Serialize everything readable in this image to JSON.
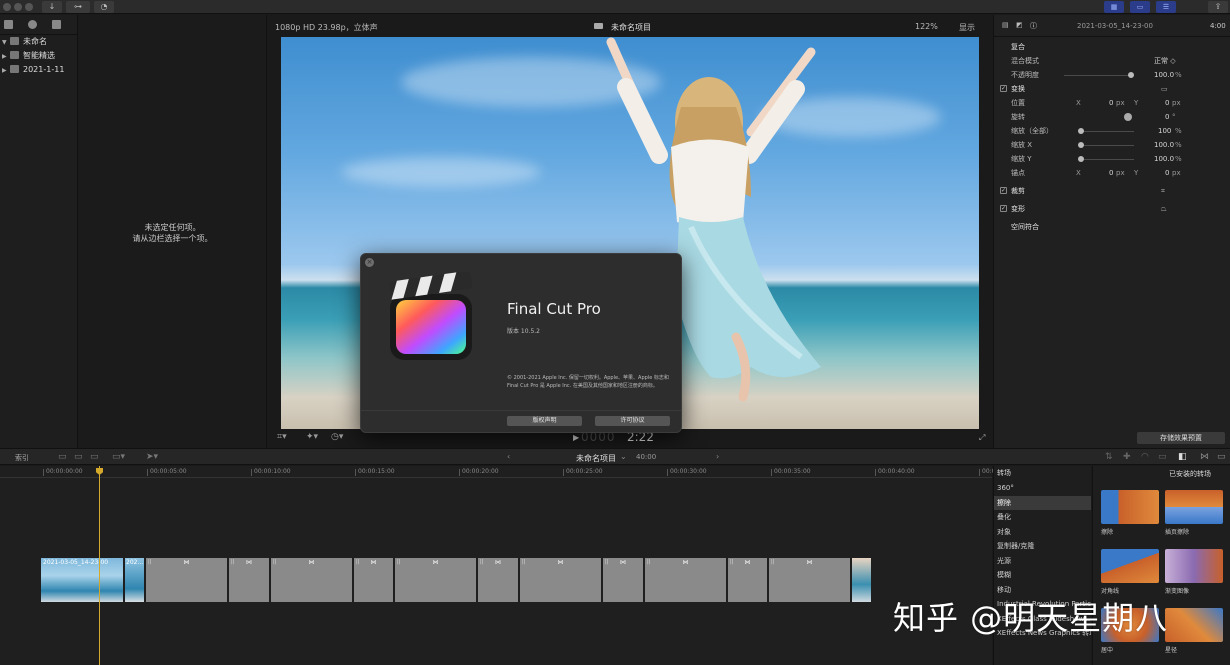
{
  "viewer": {
    "format": "1080p HD 23.98p，立体声",
    "project_title": "未命名项目",
    "zoom": "122%",
    "display_menu": "显示",
    "timecode": "2:22"
  },
  "library": {
    "items": [
      {
        "label": "未命名"
      },
      {
        "label": "智能精选"
      },
      {
        "label": "2021-1-11"
      }
    ]
  },
  "browser": {
    "empty_line1": "未选定任何项。",
    "empty_line2": "请从边栏选择一个项。"
  },
  "about": {
    "app_name": "Final Cut Pro",
    "version": "版本 10.5.2",
    "copyright": "© 2001-2021 Apple Inc. 保留一切权利。Apple、苹果、Apple 标志和 Final Cut Pro 是 Apple Inc. 在美国及其他国家和地区注册的商标。",
    "btn_license": "版权声明",
    "btn_agreement": "许可协议"
  },
  "inspector": {
    "clip_name": "2021-03-05_14-23-00",
    "duration": "4:00",
    "composite": {
      "title": "复合",
      "blend_label": "混合模式",
      "blend_value": "正常 ◇",
      "opacity_label": "不透明度",
      "opacity_value": "100.0",
      "opacity_unit": "%"
    },
    "transform": {
      "title": "变换",
      "position_label": "位置",
      "rotation_label": "旋转",
      "scale_all_label": "缩放（全部）",
      "scale_x_label": "缩放 X",
      "scale_y_label": "缩放 Y",
      "anchor_label": "锚点",
      "axis_x": "X",
      "axis_y": "Y",
      "zero": "0",
      "px": "px",
      "deg": "°",
      "pct": "%",
      "scale_all": "100",
      "scale_x": "100.0",
      "scale_y": "100.0"
    },
    "crop_label": "裁剪",
    "distort_label": "变形",
    "spatial_label": "空间符合",
    "save_preset": "存储效果预置"
  },
  "timeline": {
    "index_label": "索引",
    "project_title": "未命名项目",
    "project_duration": "40:00",
    "ruler": [
      "00:00:00:00",
      "00:00:05:00",
      "00:00:10:00",
      "00:00:15:00",
      "00:00:20:00",
      "00:00:25:00",
      "00:00:30:00",
      "00:00:35:00",
      "00:00:40:00",
      "00:00:45:00"
    ],
    "clip_label": "2021-03-05_14-23-00",
    "clip_label_short": "202..."
  },
  "transitions": {
    "title": "转场",
    "installed": "已安装的转场",
    "categories": [
      "360°",
      "擦除",
      "叠化",
      "对象",
      "复制器/克隆",
      "光源",
      "模糊",
      "移动",
      "Industrial Revolution Particle...",
      "XEffects Glass Slideshow...",
      "XEffects News Graphics 转场"
    ],
    "thumbs": [
      "擦除",
      "插页擦除",
      "对角线",
      "渐变图像",
      "居中",
      "星径"
    ]
  },
  "watermark": "知乎 @明天星期八",
  "colors": {
    "accent": "#d4a92b",
    "panel": "#202020",
    "button_blue": "#2a3c8a"
  }
}
